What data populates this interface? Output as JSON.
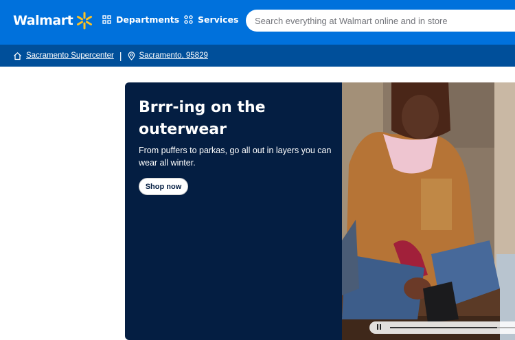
{
  "header": {
    "brand": "Walmart",
    "departments_label": "Departments",
    "services_label": "Services",
    "search_placeholder": "Search everything at Walmart online and in store"
  },
  "location": {
    "store": "Sacramento Supercenter",
    "separator": "|",
    "address": "Sacramento, 95829"
  },
  "hero": {
    "title": "Brrr-ing on the outerwear",
    "subtitle": "From puffers to parkas, go all out in layers you can wear all winter.",
    "cta_label": "Shop now",
    "carousel_progress": 0.78
  },
  "colors": {
    "brand_blue": "#0071dc",
    "location_bar": "#004f9a",
    "hero_navy": "#041e42",
    "spark_yellow": "#ffc220"
  },
  "icons": {
    "spark": "walmart-spark-icon",
    "departments": "grid-icon",
    "services": "grid-icon",
    "store": "home-icon",
    "address": "location-pin-icon",
    "carousel": "pause-icon"
  }
}
